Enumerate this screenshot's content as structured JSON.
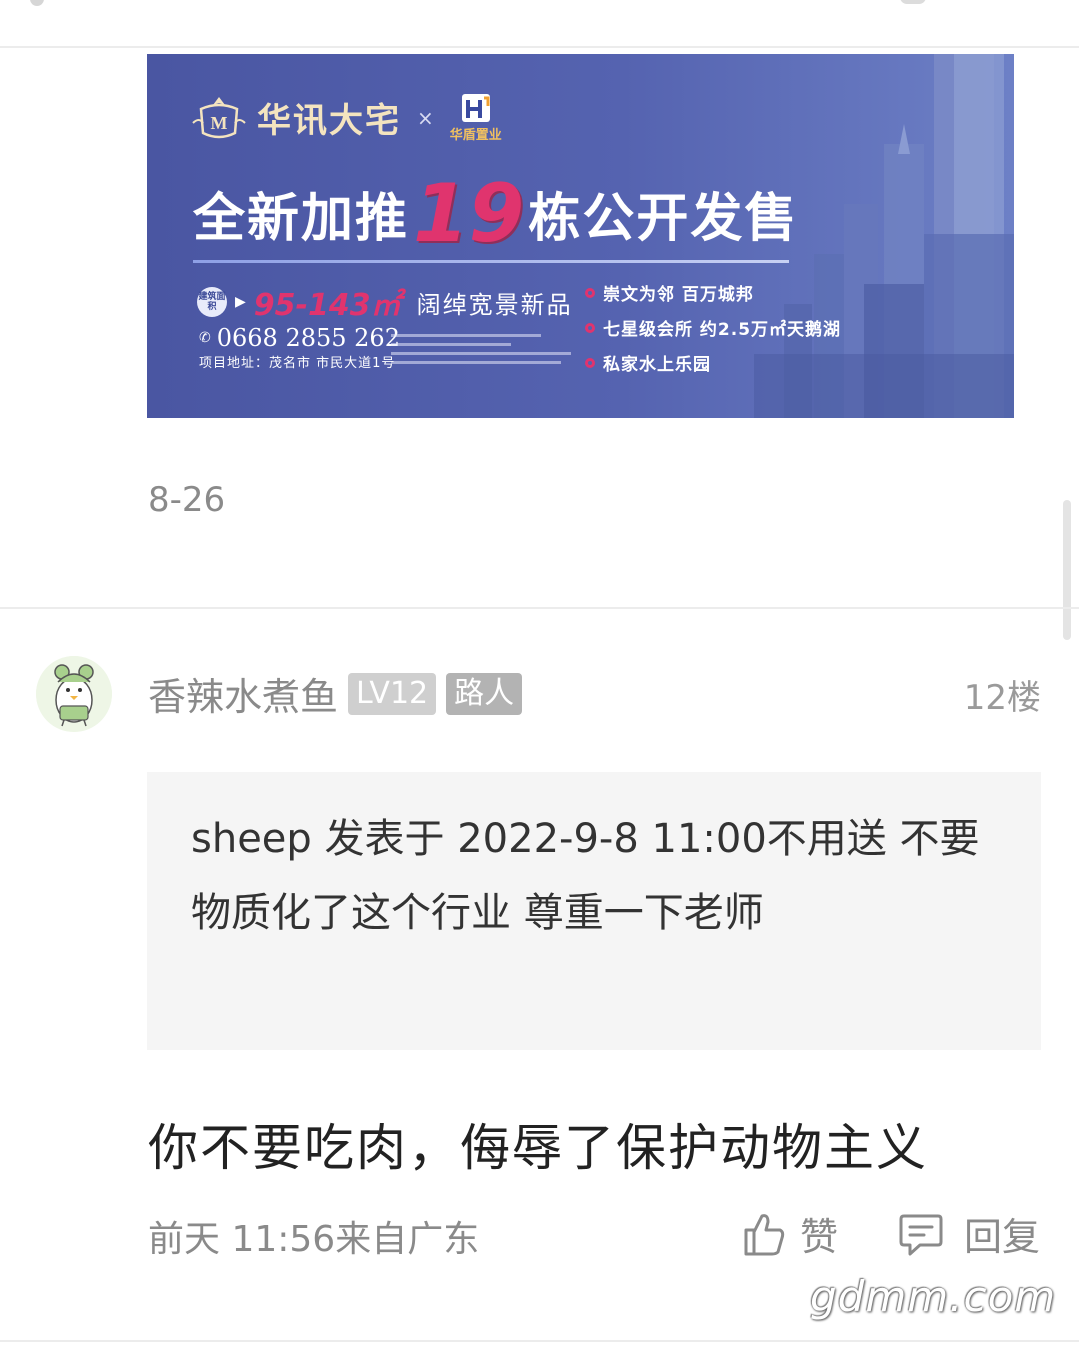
{
  "banner": {
    "brand": "华讯大宅",
    "times": "×",
    "partner": "华盾置业",
    "headline_pre": "全新加推",
    "headline_num": "19",
    "headline_post": "栋公开发售",
    "area_badge": "建筑面积",
    "area_value": "95-143㎡",
    "area_desc": "阔绰宽景新品",
    "phone": "0668 2855 262",
    "address": "项目地址：茂名市 市民大道1号",
    "features": [
      "崇文为邻  百万城邦",
      "七星级会所  约2.5万㎡天鹅湖",
      "私家水上乐园"
    ]
  },
  "post": {
    "date": "8-26"
  },
  "comment": {
    "username": "香辣水煮鱼",
    "level_badge": "LV12",
    "role_badge": "路人",
    "floor": "12楼",
    "quote": "sheep 发表于 2022-9-8 11:00不用送  不要物质化了这个行业 尊重一下老师",
    "text": "你不要吃肉，侮辱了保护动物主义",
    "meta": "前天 11:56来自广东",
    "like_label": "赞",
    "reply_label": "回复"
  },
  "watermark": "gdmm.com",
  "icons": [
    "crest-logo",
    "partner-logo",
    "thumbs-up-icon",
    "comment-icon",
    "avatar-frog-duck"
  ]
}
